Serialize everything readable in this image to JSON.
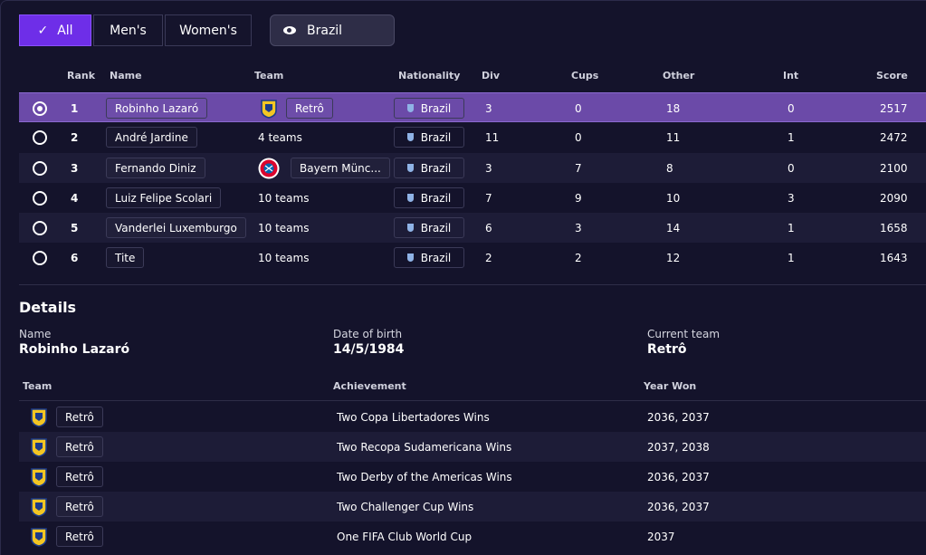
{
  "filters": {
    "all_label": "All",
    "mens_label": "Men's",
    "womens_label": "Women's",
    "nationality_label": "Brazil"
  },
  "table": {
    "columns": [
      "Rank",
      "Name",
      "Team",
      "Nationality",
      "Div",
      "Cups",
      "Other",
      "Int",
      "Score"
    ],
    "rows": [
      {
        "rank": "1",
        "name": "Robinho Lazaró",
        "team": "Retrô",
        "team_logo": "retro-crest",
        "nationality": "Brazil",
        "div": "3",
        "cups": "0",
        "other": "18",
        "int": "0",
        "score": "2517",
        "selected": true
      },
      {
        "rank": "2",
        "name": "André Jardine",
        "team": "4 teams",
        "team_logo": "",
        "nationality": "Brazil",
        "div": "11",
        "cups": "0",
        "other": "11",
        "int": "1",
        "score": "2472",
        "selected": false
      },
      {
        "rank": "3",
        "name": "Fernando Diniz",
        "team": "Bayern Münc...",
        "team_logo": "bayern-crest",
        "nationality": "Brazil",
        "div": "3",
        "cups": "7",
        "other": "8",
        "int": "0",
        "score": "2100",
        "selected": false
      },
      {
        "rank": "4",
        "name": "Luiz Felipe Scolari",
        "team": "10 teams",
        "team_logo": "",
        "nationality": "Brazil",
        "div": "7",
        "cups": "9",
        "other": "10",
        "int": "3",
        "score": "2090",
        "selected": false
      },
      {
        "rank": "5",
        "name": "Vanderlei Luxemburgo",
        "team": "10 teams",
        "team_logo": "",
        "nationality": "Brazil",
        "div": "6",
        "cups": "3",
        "other": "14",
        "int": "1",
        "score": "1658",
        "selected": false
      },
      {
        "rank": "6",
        "name": "Tite",
        "team": "10 teams",
        "team_logo": "",
        "nationality": "Brazil",
        "div": "2",
        "cups": "2",
        "other": "12",
        "int": "1",
        "score": "1643",
        "selected": false
      }
    ]
  },
  "details": {
    "title": "Details",
    "name_label": "Name",
    "name_value": "Robinho Lazaró",
    "dob_label": "Date of birth",
    "dob_value": "14/5/1984",
    "team_label": "Current team",
    "team_value": "Retrô",
    "achievements": {
      "columns": [
        "Team",
        "Achievement",
        "Year Won"
      ],
      "rows": [
        {
          "team": "Retrô",
          "achievement": "Two Copa Libertadores Wins",
          "year": "2036, 2037"
        },
        {
          "team": "Retrô",
          "achievement": "Two Recopa Sudamericana Wins",
          "year": "2037, 2038"
        },
        {
          "team": "Retrô",
          "achievement": "Two Derby of the Americas Wins",
          "year": "2036, 2037"
        },
        {
          "team": "Retrô",
          "achievement": "Two Challenger Cup Wins",
          "year": "2036, 2037"
        },
        {
          "team": "Retrô",
          "achievement": "One FIFA Club World Cup",
          "year": "2037"
        }
      ]
    }
  },
  "colors": {
    "background": "#14132b",
    "accent": "#6e2ee8",
    "selected_row": "#6b4aa8",
    "alt_row": "#1d1c37"
  }
}
